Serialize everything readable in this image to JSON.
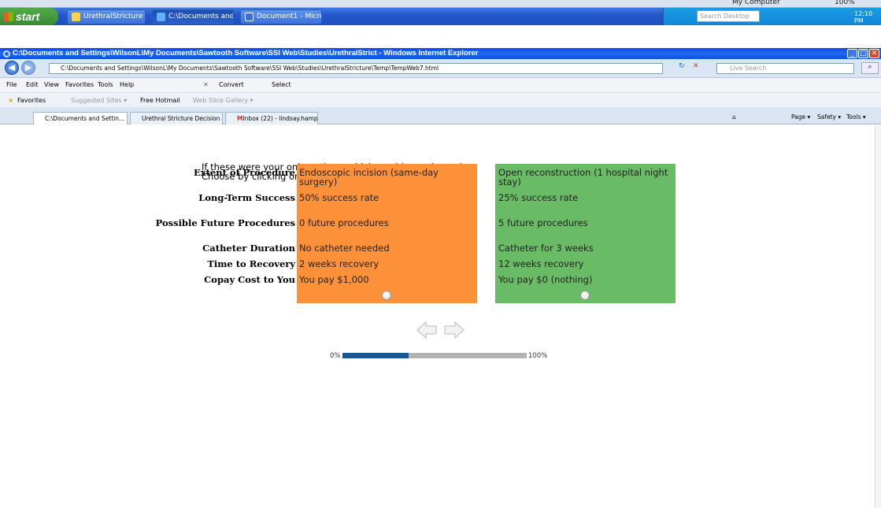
{
  "desktop": {
    "my_computer": "My Computer",
    "zoom": "100%",
    "start_label": "start",
    "taskbar_items": [
      "UrethralStricture - Sa...",
      "C:\\Documents and Se...",
      "Document1 - Microsof..."
    ],
    "search_desktop": "Search Desktop",
    "clock": "12:10 PM"
  },
  "browser": {
    "window_title": "C:\\Documents and Settings\\WilsonL\\My Documents\\Sawtooth Software\\SSI Web\\Studies\\UrethralStrict - Windows Internet Explorer",
    "address": "C:\\Documents and Settings\\WilsonL\\My Documents\\Sawtooth Software\\SSI Web\\Studies\\UrethralStricture\\Temp\\TempWeb7.html",
    "live_search": "Live Search",
    "menu": [
      "File",
      "Edit",
      "View",
      "Favorites",
      "Tools",
      "Help"
    ],
    "convert": "Convert",
    "select": "Select",
    "favorites_label": "Favorites",
    "favorites_links": [
      "Suggested Sites ▾",
      "Free Hotmail",
      "Web Slice Gallery ▾"
    ],
    "tabs": [
      "C:\\Documents and Settin...",
      "Urethral Stricture Decision A...",
      "Inbox (22) - lindsay.hampso..."
    ],
    "command_bar": [
      "Page ▾",
      "Safety ▾",
      "Tools ▾"
    ]
  },
  "survey": {
    "prompt_line1": "If these were your only options, which would you choose?",
    "prompt_line2": "Choose by clicking one of the buttons below:",
    "attributes": [
      {
        "label": "Extent of Procedure",
        "a": "Endoscopic incision (same-day surgery)",
        "b": "Open reconstruction (1 hospital night stay)"
      },
      {
        "label": "Long-Term Success",
        "a": "50% success rate",
        "b": "25% success rate"
      },
      {
        "label": "Possible Future Procedures",
        "a": "0 future procedures",
        "b": "5 future procedures"
      },
      {
        "label": "Catheter Duration",
        "a": "No catheter needed",
        "b": "Catheter for 3 weeks"
      },
      {
        "label": "Time to Recovery",
        "a": "2 weeks recovery",
        "b": "12 weeks recovery"
      },
      {
        "label": "Copay Cost to You",
        "a": "You pay $1,000",
        "b": "You pay $0 (nothing)"
      }
    ],
    "option_a_color": "#fc913a",
    "option_b_color": "#6abb66",
    "progress_start": "0%",
    "progress_end": "100%",
    "progress_fraction": 0.36
  }
}
